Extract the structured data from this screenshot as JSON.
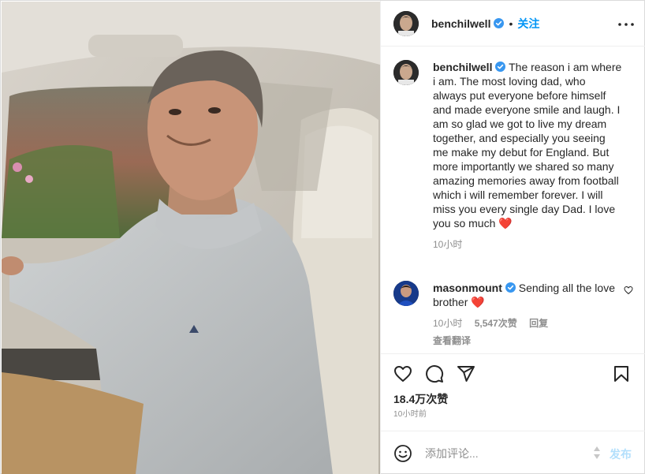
{
  "post": {
    "username": "benchilwell",
    "follow_label": "关注",
    "separator": "•"
  },
  "caption": {
    "username": "benchilwell",
    "text": "The reason i am where i am. The most loving dad, who always put everyone before himself and made everyone smile and laugh. I am so glad we got to live my dream together, and especially you seeing me make my debut for England. But more importantly we shared so many amazing memories away from football which i will remember forever. I will miss you every single day Dad. I love you so much",
    "emoji": "❤️",
    "time": "10小时"
  },
  "comment": {
    "username": "masonmount",
    "text": "Sending all the love brother",
    "emoji": "❤️",
    "time": "10小时",
    "likes": "5,547次赞",
    "reply_label": "回复",
    "translate_label": "查看翻译"
  },
  "engagement": {
    "likes": "18.4万次赞",
    "posted": "10小时前"
  },
  "composer": {
    "placeholder": "添加评论...",
    "post_label": "发布"
  },
  "icons": {
    "more": "more-options-icon",
    "verified": "verified-badge-icon",
    "like": "heart-icon",
    "comment": "comment-icon",
    "share": "paper-plane-icon",
    "save": "bookmark-icon",
    "emoji": "emoji-icon"
  },
  "colors": {
    "link": "#0095f6",
    "verified": "#3897f0",
    "heart": "#ed4956",
    "muted": "#8e8e8e",
    "post_disabled": "#b2dffc"
  }
}
